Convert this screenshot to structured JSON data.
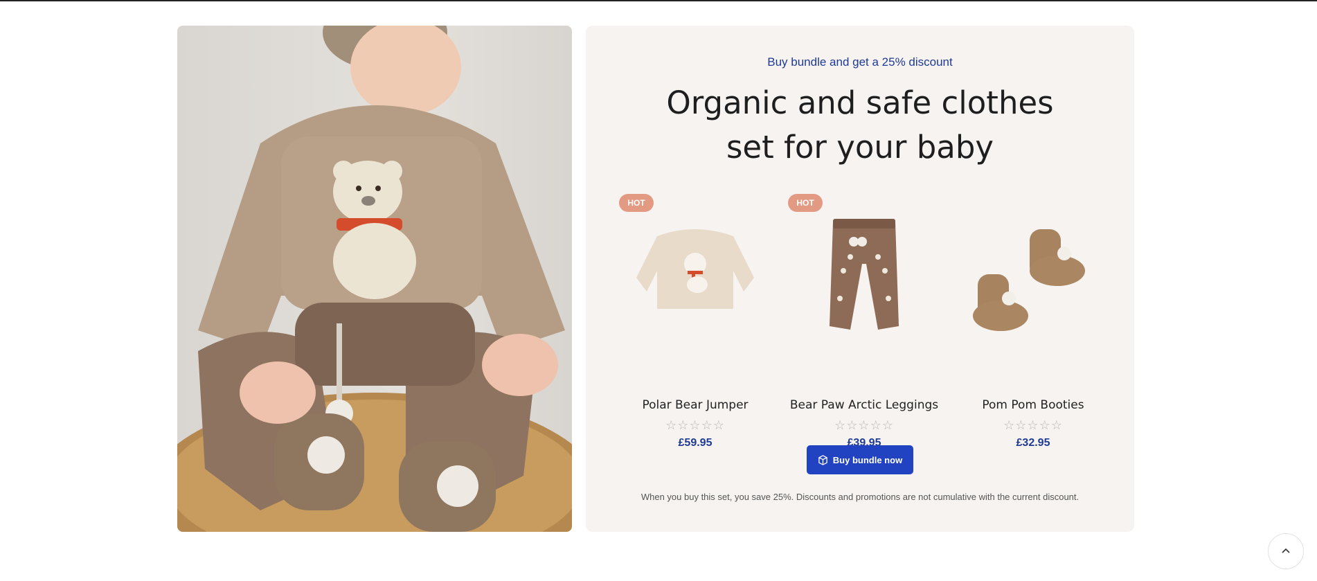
{
  "hero": {
    "image_alt": "baby-in-bear-jumper-photo"
  },
  "bundle": {
    "subtitle": "Buy bundle and get a 25% discount",
    "title": "Organic and safe clothes set for your baby",
    "button_label": "Buy bundle now",
    "note": "When you buy this set, you save 25%. Discounts and promotions are not cumulative with the current discount."
  },
  "products": [
    {
      "badge": "HOT",
      "name": "Polar Bear Jumper",
      "price": "£59.95",
      "rating": 0
    },
    {
      "badge": "HOT",
      "name": "Bear Paw Arctic Leggings",
      "price": "£39.95",
      "rating": 0
    },
    {
      "badge": "",
      "name": "Pom Pom Booties",
      "price": "£32.95",
      "rating": 0
    }
  ],
  "stars_empty": "☆☆☆☆☆",
  "colors": {
    "accent": "#2143c2",
    "price": "#1f3a94",
    "badge": "#e39a83",
    "panel_bg": "#f6f3f0"
  },
  "icons": {
    "bundle": "box-icon",
    "scroll": "chevron-up-icon"
  }
}
